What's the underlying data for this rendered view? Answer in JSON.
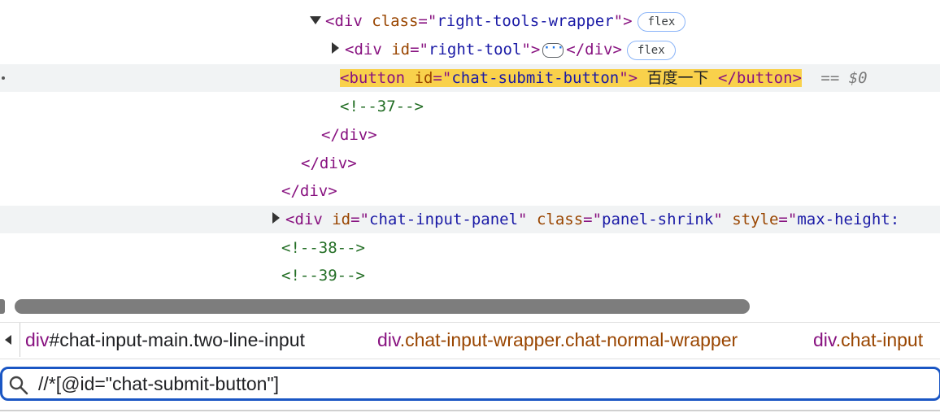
{
  "tree": {
    "l1": {
      "open": "<div",
      "attr": "class",
      "eq": "=\"",
      "val": "right-tools-wrapper",
      "close": "\">",
      "badge": "flex"
    },
    "l2": {
      "open": "<div",
      "attr": "id",
      "eq": "=\"",
      "val": "right-tool",
      "close": "\">",
      "end": "</div>",
      "badge": "flex"
    },
    "l3": {
      "open": "<button",
      "attr": "id",
      "eq": "=\"",
      "val": "chat-submit-button",
      "close": "\">",
      "text": " 百度一下 ",
      "end": "</button>",
      "ref": "== $0"
    },
    "l4": {
      "comment": "<!--37-->"
    },
    "l5": {
      "end": "</div>"
    },
    "l6": {
      "end": "</div>"
    },
    "l7": {
      "end": "</div>"
    },
    "l8": {
      "open": "<div",
      "attr1": "id",
      "val1": "chat-input-panel",
      "attr2": "class",
      "val2": "panel-shrink",
      "attr3": "style",
      "val3": "max-height:"
    },
    "l9": {
      "comment": "<!--38-->"
    },
    "l10": {
      "comment": "<!--39-->"
    }
  },
  "breadcrumbs": [
    {
      "tag": "div",
      "rest": "#chat-input-main.two-line-input"
    },
    {
      "tag": "div",
      "rest": ".chat-input-wrapper.chat-normal-wrapper"
    },
    {
      "tag": "div",
      "rest": ".chat-input"
    }
  ],
  "search": {
    "value": "//*[@id=\"chat-submit-button\"]"
  },
  "colors": {
    "tag": "#881280",
    "attr": "#994500",
    "value": "#1a1aa6",
    "comment": "#236e25",
    "highlight": "#f9d14b",
    "search_border": "#1a56c4"
  },
  "icons": {
    "expand": "triangle-down-icon",
    "collapse": "triangle-right-icon",
    "more": "ellipsis-icon",
    "search": "search-icon",
    "back": "chevron-left-icon"
  }
}
